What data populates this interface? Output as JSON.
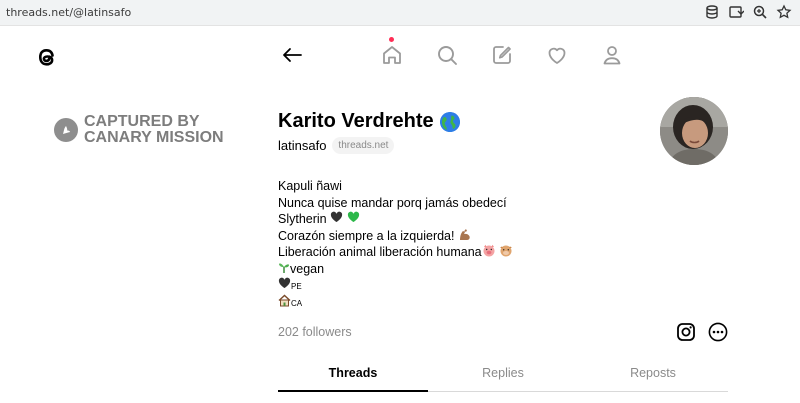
{
  "browser": {
    "url": "threads.net/@latinsafo",
    "toolbar_icons": [
      "database-icon",
      "install-icon",
      "zoom-icon",
      "bookmark-icon"
    ]
  },
  "nav": {
    "items": [
      "back-arrow-icon",
      "home-icon",
      "search-icon",
      "compose-icon",
      "heart-icon",
      "profile-icon"
    ],
    "home_has_notification": true,
    "notification_color": "#ff2d55"
  },
  "watermark": {
    "line1": "CAPTURED BY",
    "line2": "CANARY MISSION"
  },
  "profile": {
    "name": "Karito Verdrehte",
    "name_emoji": "globe-icon",
    "handle": "latinsafo",
    "domain_badge": "threads.net",
    "bio": [
      "Kapuli ñawi",
      "Nunca quise mandar porq jamás obedecí",
      "Slytherin",
      "Corazón siempre a la izquierda!",
      "Liberación animal liberación humana",
      "vegan",
      "PE",
      "CA"
    ],
    "followers": "202 followers"
  },
  "tabs": [
    {
      "label": "Threads",
      "active": true
    },
    {
      "label": "Replies",
      "active": false
    },
    {
      "label": "Reposts",
      "active": false
    }
  ],
  "colors": {
    "text": "#101010",
    "muted": "#8a8a8a",
    "accent_green": "#2db84a",
    "heart_black": "#333333"
  }
}
